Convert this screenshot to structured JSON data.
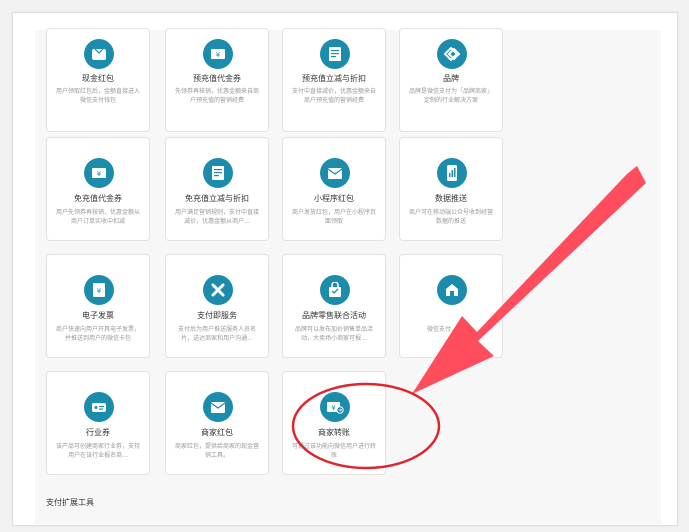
{
  "cards": [
    {
      "title": "现金红包",
      "desc": "用户领取红包后，金额直接进入微信支付钱包",
      "icon": "wallet-icon"
    },
    {
      "title": "预充值代金券",
      "desc": "先领券再核销，优惠金额来自商户预充值的营销经费",
      "icon": "coupon-icon"
    },
    {
      "title": "预充值立减与折扣",
      "desc": "支付中直接减价，优惠金额来自商户预充值的营销经费",
      "icon": "discount-icon"
    },
    {
      "title": "品牌",
      "desc": "品牌是微信支付为「品牌商家」定制的行业解决方案",
      "icon": "brand-icon"
    },
    {
      "title": "免充值代金券",
      "desc": "用户先领券再核销，优惠金额从商户订单实收中扣减",
      "icon": "coupon-icon"
    },
    {
      "title": "免充值立减与折扣",
      "desc": "用户满足营销规则，支付中直接减价，优惠金额从商户...",
      "icon": "discount-icon"
    },
    {
      "title": "小程序红包",
      "desc": "商户发放红包，用户在小程序页面领取",
      "icon": "envelope-icon"
    },
    {
      "title": "数据推送",
      "desc": "商户可在移动端公众号收到经营数据的推送",
      "icon": "data-push-icon"
    },
    {
      "title": "电子发票",
      "desc": "商户快速向用户开具电子发票，并推送到用户的微信卡包",
      "icon": "invoice-icon"
    },
    {
      "title": "支付即服务",
      "desc": "支付后为用户推送服务人员名片，送达商家和用户沟通...",
      "icon": "service-icon"
    },
    {
      "title": "品牌零售联合活动",
      "desc": "品牌可以发布加价销售单品活动，大卖场小商家可报...",
      "icon": "retail-bag-icon"
    },
    {
      "title": "",
      "desc": "微信支付…一条…",
      "icon": "store-icon"
    },
    {
      "title": "行业券",
      "desc": "该产品可创建商家行业券，支持用户在该行业报名商...",
      "icon": "industry-coupon-icon"
    },
    {
      "title": "商家红包",
      "desc": "商家红包，提供给商家的现金营销工具。",
      "icon": "envelope-icon"
    },
    {
      "title": "商家转账",
      "desc": "可通过该功能向微信用户进行转账",
      "icon": "transfer-icon"
    }
  ],
  "footer": {
    "label": "支付扩展工具"
  },
  "colors": {
    "accent": "#1c8cad",
    "arrow": "#ff4d5e",
    "circle": "#e0262d"
  }
}
